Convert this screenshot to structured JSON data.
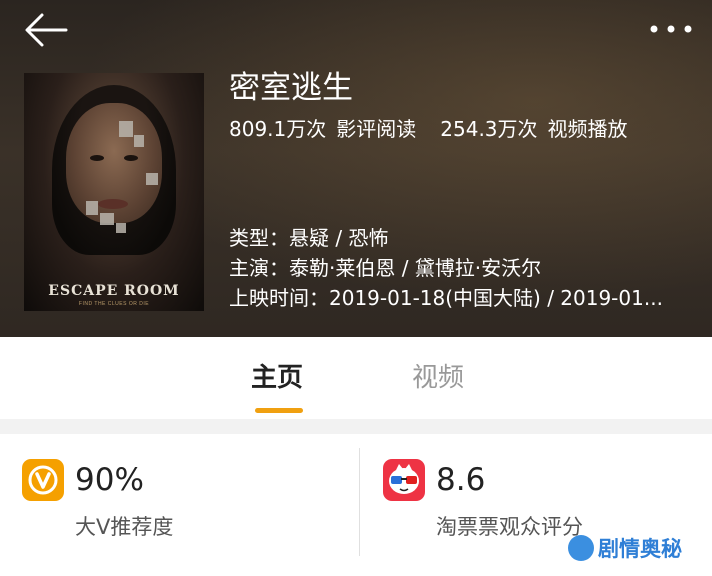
{
  "header": {
    "back_icon": "arrow-left-icon",
    "more_icon": "more-dots-icon"
  },
  "movie": {
    "title": "密室逃生",
    "poster_title": "ESCAPE ROOM",
    "poster_tagline": "FIND THE CLUES OR DIE",
    "reads": "809.1万次",
    "reads_label": "影评阅读",
    "plays": "254.3万次",
    "plays_label": "视频播放",
    "genre": "类型：悬疑 / 恐怖",
    "cast": "主演：泰勒·莱伯恩 / 黛博拉·安沃尔",
    "release": "上映时间：2019-01-18(中国大陆) / 2019-01..."
  },
  "tabs": [
    {
      "label": "主页",
      "active": true
    },
    {
      "label": "视频",
      "active": false
    }
  ],
  "ratings": {
    "bigv": {
      "score": "90%",
      "label": "大V推荐度",
      "color": "#f5a000",
      "icon": "bigv-logo-icon"
    },
    "taopiaopiao": {
      "score": "8.6",
      "label": "淘票票观众评分",
      "color": "#ee3344",
      "icon": "taopiaopiao-logo-icon"
    }
  },
  "watermark": {
    "text": "剧情奥秘"
  },
  "colors": {
    "accent": "#f0a010",
    "hero_bg": "#3a3128"
  }
}
